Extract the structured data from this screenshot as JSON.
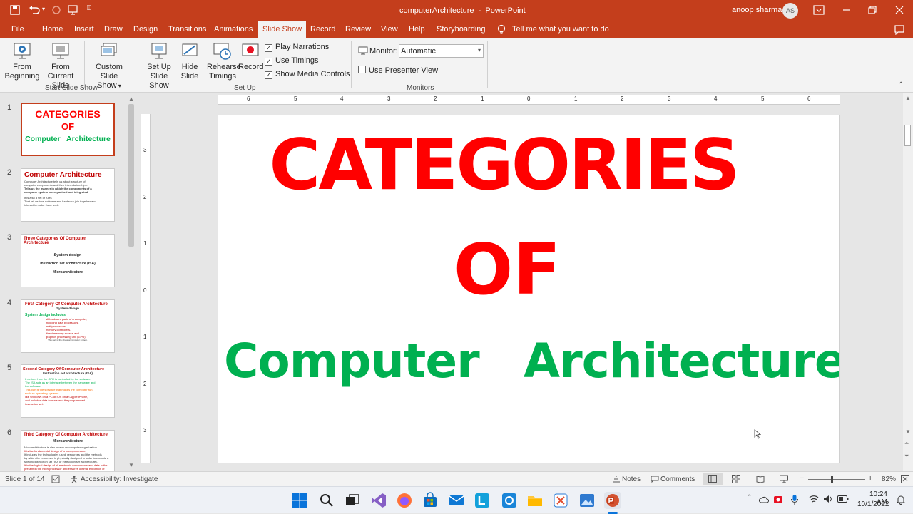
{
  "window": {
    "title": "computerArchitecture  -  PowerPoint",
    "user": "anoop sharma",
    "avatar": "AS"
  },
  "menus": [
    "File",
    "Home",
    "Insert",
    "Draw",
    "Design",
    "Transitions",
    "Animations",
    "Slide Show",
    "Record",
    "Review",
    "View",
    "Help",
    "Storyboarding"
  ],
  "active_menu": "Slide Show",
  "tell_me": "Tell me what you want to do",
  "ribbon": {
    "from_beginning": "From\nBeginning",
    "from_current": "From\nCurrent Slide",
    "custom_show": "Custom Slide\nShow",
    "group1": "Start Slide Show",
    "setup_show": "Set Up\nSlide Show",
    "hide_slide": "Hide\nSlide",
    "rehearse": "Rehearse\nTimings",
    "record": "Record",
    "play_narrations": "Play Narrations",
    "use_timings": "Use Timings",
    "show_media": "Show Media Controls",
    "group2": "Set Up",
    "monitor_label": "Monitor:",
    "monitor_value": "Automatic",
    "presenter_view": "Use Presenter View",
    "group3": "Monitors"
  },
  "ruler_h": [
    "6",
    "5",
    "4",
    "3",
    "2",
    "1",
    "0",
    "1",
    "2",
    "3",
    "4",
    "5",
    "6"
  ],
  "ruler_v": [
    "3",
    "2",
    "1",
    "0",
    "1",
    "2",
    "3"
  ],
  "thumbnails": [
    {
      "num": "1",
      "title1": "CATEGORIES",
      "title2": "OF",
      "title3": "Computer   Architecture"
    },
    {
      "num": "2",
      "title": "Computer Architecture",
      "body": [
        "Computer Architecture tells us about    structure of",
        "computer components and their interrelationships.",
        "Tells us the manner in which the components of a",
        "computer system are organised and integrated.",
        "",
        "It is also a set of rules",
        "That tell us  how software and hardware join together and",
        "interact to make them work."
      ]
    },
    {
      "num": "3",
      "title": "Three Categories Of Computer Architecture",
      "body": [
        "System design",
        "Instruction set architecture (ISA)",
        "Microarchitecture"
      ]
    },
    {
      "num": "4",
      "title": "First Category Of Computer Architecture",
      "sub": "System design",
      "green": "System design includes",
      "body": [
        "all hardware parts of a computer,",
        "including data processors,",
        "multiprocessors,",
        "memory controllers,",
        "direct memory access and",
        "graphics processing unit (GPU)",
        "This part is the physical computer system."
      ]
    },
    {
      "num": "5",
      "title": "Second Category Of Computer Architecture",
      "sub": "Instruction set architecture (ISA)",
      "body": [
        "It defines how the CPU is controlled by the software.",
        "The ISA acts as an interface between the hardware and",
        "the software.",
        "This part is the software that makes the computer run,",
        "such as operating systems",
        "like Windows on a PC or iOS on an Apple iPhone,",
        "and includes data formats and the programmed",
        "instruction set."
      ]
    },
    {
      "num": "6",
      "title": "Third Category Of Computer Architecture",
      "sub": "Microarchitecture",
      "body": [
        "Microarchitecture is also known as computer organization.",
        "It is the fundamental design of a microprocessor.",
        "It includes the technologies used, resources and the methods",
        "by which the processor is physically designed in order to execute a",
        "specific instruction set (ISA or instruction set architecture).",
        "It is the logical design of all electronic components and data paths",
        "present in the microprocessor and ensures optimal execution of"
      ]
    }
  ],
  "slide": {
    "line1": "CATEGORIES",
    "line2": "OF",
    "line3a": "Computer",
    "line3b": "Architecture"
  },
  "status": {
    "slide_info": "Slide 1 of 14",
    "accessibility": "Accessibility: Investigate",
    "notes": "Notes",
    "comments": "Comments",
    "zoom": "82%"
  },
  "clock": {
    "time": "10:24 AM",
    "date": "10/1/2022"
  },
  "colors": {
    "accent": "#c43e1c",
    "red": "#ff0000",
    "green": "#00b050"
  }
}
